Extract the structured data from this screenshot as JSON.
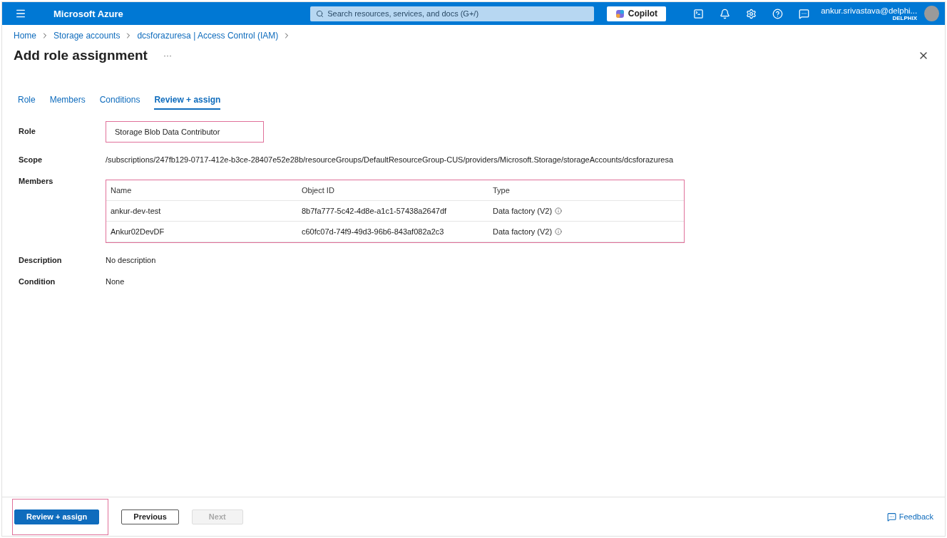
{
  "top_bar": {
    "brand": "Microsoft Azure",
    "search": {
      "placeholder": "Search resources, services, and docs (G+/)"
    },
    "copilot": "Copilot",
    "account": {
      "name": "ankur.srivastava@delphi...",
      "org": "DELPHIX"
    }
  },
  "breadcrumb": [
    "Home",
    "Storage accounts",
    "dcsforazuresa | Access Control (IAM)"
  ],
  "title": "Add role assignment",
  "more": "···",
  "tabs": [
    {
      "label": "Role",
      "selected": false
    },
    {
      "label": "Members",
      "selected": false
    },
    {
      "label": "Conditions",
      "selected": false
    },
    {
      "label": "Review + assign",
      "selected": true
    }
  ],
  "role": {
    "label": "Role",
    "value": "Storage Blob Data Contributor",
    "highlighted": true
  },
  "scope": {
    "label": "Scope",
    "value": "/subscriptions/247fb129-0717-412e-b3ce-28407e52e28b/resourceGroups/DefaultResourceGroup-CUS/providers/Microsoft.Storage/storageAccounts/dcsforazuresa"
  },
  "members": {
    "label": "Members",
    "highlighted": true,
    "columns": [
      "Name",
      "Object ID",
      "Type"
    ],
    "rows": [
      {
        "name": "ankur-dev-test",
        "object_id": "8b7fa777-5c42-4d8e-a1c1-57438a2647df",
        "type": "Data factory (V2)"
      },
      {
        "name": "Ankur02DevDF",
        "object_id": "c60fc07d-74f9-49d3-96b6-843af082a2c3",
        "type": "Data factory (V2)"
      }
    ]
  },
  "description": {
    "label": "Description",
    "value": "No description"
  },
  "condition": {
    "label": "Condition",
    "value": "None"
  },
  "footer": {
    "buttons": [
      {
        "label": "Review + assign",
        "kind": "primary",
        "disabled": false,
        "highlighted": true
      },
      {
        "label": "Previous",
        "kind": "secondary",
        "disabled": false,
        "highlighted": false
      },
      {
        "label": "Next",
        "kind": "secondary",
        "disabled": true,
        "highlighted": false
      }
    ],
    "feedback": "Feedback"
  }
}
